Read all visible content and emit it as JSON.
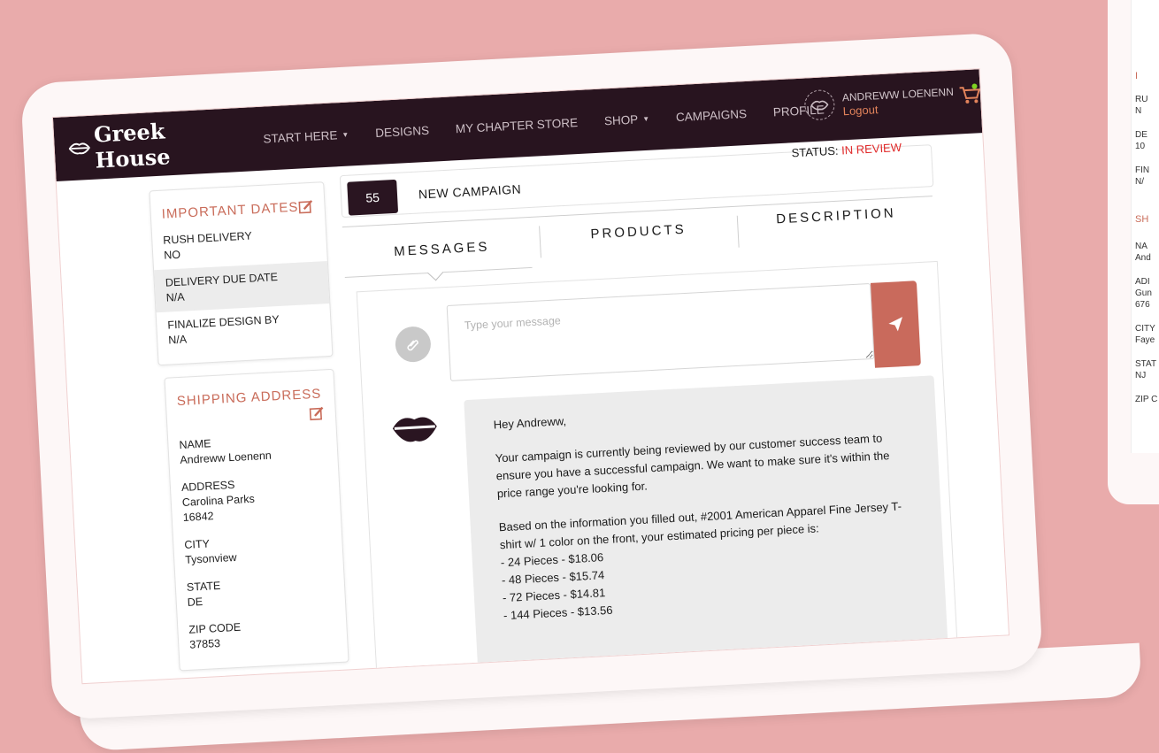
{
  "brand": {
    "name": "Greek House"
  },
  "nav": {
    "items": [
      {
        "label": "START HERE",
        "dropdown": true
      },
      {
        "label": "DESIGNS",
        "dropdown": false
      },
      {
        "label": "MY CHAPTER STORE",
        "dropdown": false
      },
      {
        "label": "SHOP",
        "dropdown": true
      },
      {
        "label": "CAMPAIGNS",
        "dropdown": false
      },
      {
        "label": "PROFILE",
        "dropdown": false
      }
    ],
    "user_name": "ANDREWW LOENENN",
    "logout_label": "Logout"
  },
  "campaign": {
    "number": "55",
    "title": "NEW CAMPAIGN",
    "status_label": "STATUS:",
    "status_value": "IN REVIEW",
    "status_color": "#e02a2a"
  },
  "tabs": [
    "MESSAGES",
    "PRODUCTS",
    "DESCRIPTION"
  ],
  "important_dates": {
    "title": "IMPORTANT DATES",
    "rows": [
      {
        "label": "RUSH DELIVERY",
        "value": "NO"
      },
      {
        "label": "DELIVERY DUE DATE",
        "value": "N/A"
      },
      {
        "label": "FINALIZE DESIGN BY",
        "value": "N/A"
      }
    ]
  },
  "shipping": {
    "title": "SHIPPING ADDRESS",
    "rows": [
      {
        "label": "NAME",
        "value": "Andreww Loenenn"
      },
      {
        "label": "ADDRESS",
        "value": "Carolina Parks",
        "value2": "16842"
      },
      {
        "label": "CITY",
        "value": "Tysonview"
      },
      {
        "label": "STATE",
        "value": "DE"
      },
      {
        "label": "ZIP CODE",
        "value": "37853"
      }
    ]
  },
  "message_box": {
    "placeholder": "Type your message"
  },
  "message": {
    "greeting": "Hey Andreww,",
    "para1": "Your campaign is currently being reviewed by our customer success team to ensure you have a successful campaign. We want to make sure it's within the price range you're looking for.",
    "para2": "Based on the information you filled out, #2001 American Apparel Fine Jersey T-shirt w/ 1 color on the front, your estimated pricing per piece is:",
    "pricing": [
      "- 24 Pieces - $18.06",
      "- 48 Pieces - $15.74",
      "- 72 Pieces - $14.81",
      "- 144 Pieces - $13.56"
    ]
  },
  "colors": {
    "navbar": "#28141f",
    "accent": "#c96a5c",
    "background": "#e9abab",
    "logout": "#e2835b"
  },
  "second_screen": {
    "fragments": [
      "I",
      "RU",
      "N",
      "DE",
      "10",
      "FIN",
      "N/",
      "SH",
      "NA",
      "And",
      "ADI",
      "Gun",
      "676",
      "CITY",
      "Faye",
      "STAT",
      "NJ",
      "ZIP C"
    ]
  }
}
